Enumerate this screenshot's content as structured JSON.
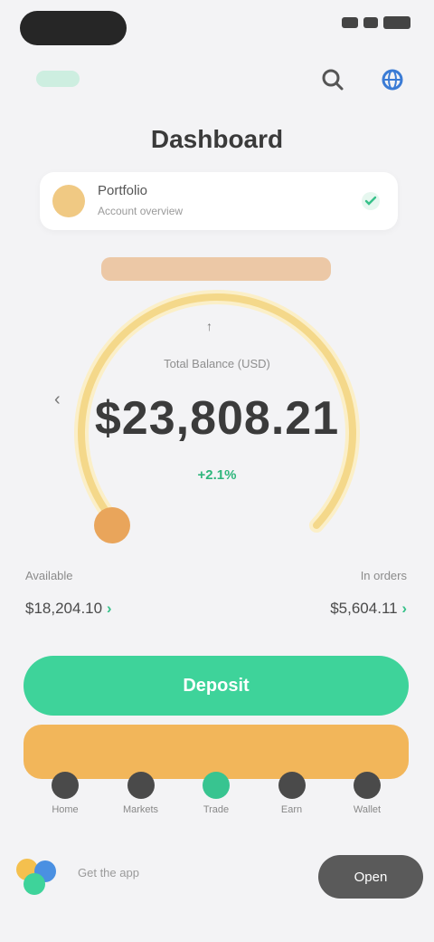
{
  "status": {
    "pill": "",
    "icons": [
      "signal-icon",
      "wifi-icon",
      "battery-icon"
    ]
  },
  "header": {
    "title": "Dashboard",
    "search_icon": "search-icon",
    "globe_icon": "globe-icon"
  },
  "account_card": {
    "title": "Portfolio",
    "subtitle": "Account overview",
    "check_icon": "check-icon"
  },
  "summary": {
    "banner": "",
    "top_hint": "↑",
    "caption": "Total Balance (USD)",
    "amount": "$23,808.21",
    "link": "+2.1%",
    "left_arrow": "‹",
    "arc_color": "#f4d88a",
    "arc_bg_color": "#fbefc8"
  },
  "stats": {
    "left_label": "Available",
    "right_label": "In orders",
    "left_value": "$18,204.10",
    "right_value": "$5,604.11",
    "chevron": "›"
  },
  "primary_button": {
    "label": "Deposit"
  },
  "nav": {
    "items": [
      {
        "label": "Home",
        "icon": "home-icon"
      },
      {
        "label": "Markets",
        "icon": "chart-icon"
      },
      {
        "label": "Trade",
        "icon": "swap-icon"
      },
      {
        "label": "Earn",
        "icon": "coin-icon"
      },
      {
        "label": "Wallet",
        "icon": "wallet-icon"
      }
    ]
  },
  "footer": {
    "text": "Get the app",
    "button": "Open"
  },
  "colors": {
    "accent_green": "#3ed39a",
    "orange": "#f2b65a",
    "background": "#f3f3f5"
  }
}
